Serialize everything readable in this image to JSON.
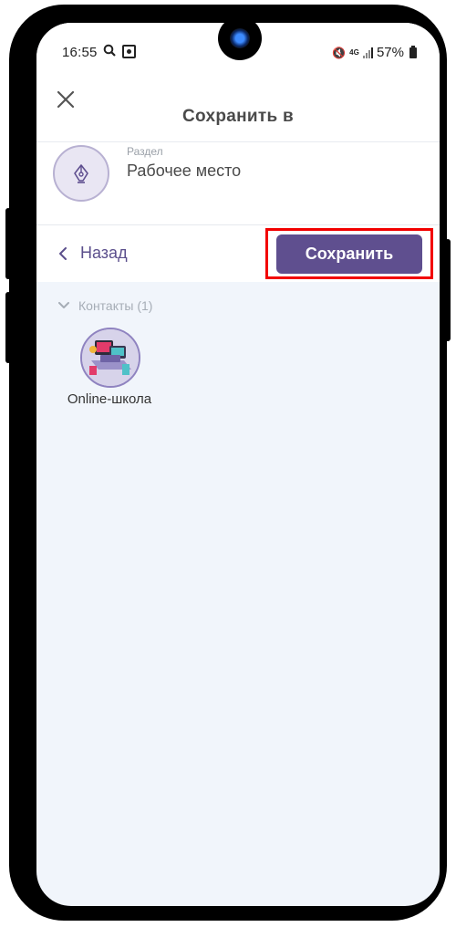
{
  "status_bar": {
    "time": "16:55",
    "network": "4G",
    "battery": "57%"
  },
  "header": {
    "title": "Сохранить в",
    "close_icon": "close-icon"
  },
  "section": {
    "caption": "Раздел",
    "name": "Рабочее место",
    "icon": "pen-nib-icon"
  },
  "actions": {
    "back_label": "Назад",
    "save_label": "Сохранить"
  },
  "contacts": {
    "header": "Контакты (1)",
    "items": [
      {
        "name": "Online-школа"
      }
    ]
  },
  "colors": {
    "accent": "#5f4f8f",
    "highlight": "#f20000",
    "background": "#f1f5fb"
  }
}
